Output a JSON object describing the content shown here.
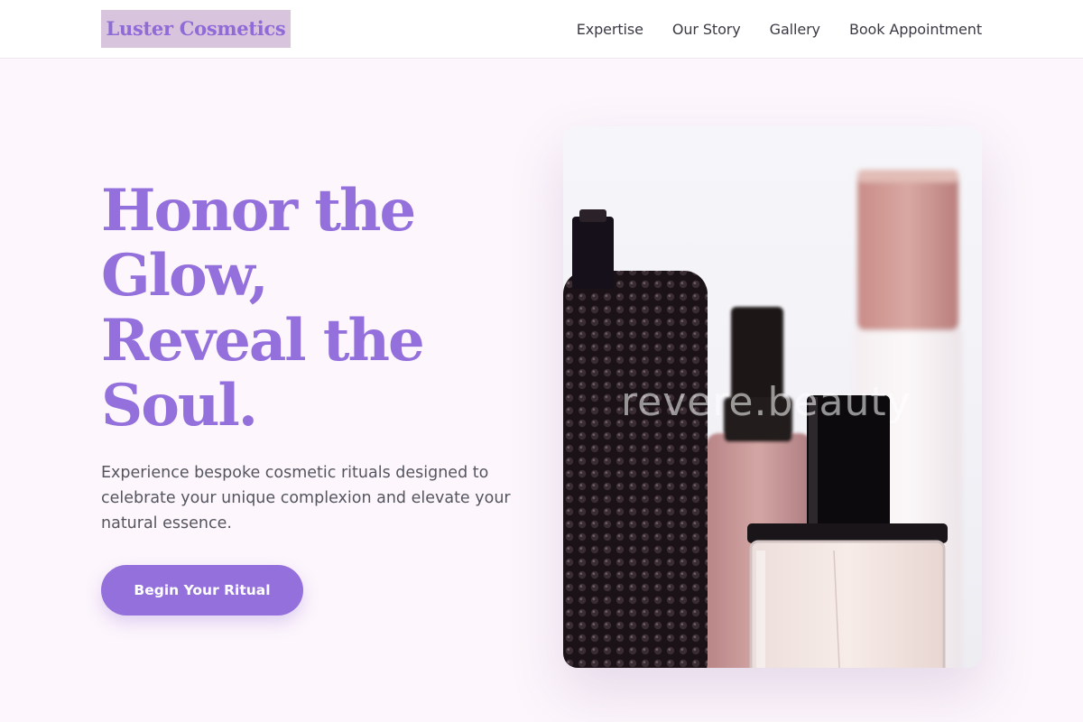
{
  "header": {
    "logo": "Luster Cosmetics",
    "nav": [
      "Expertise",
      "Our Story",
      "Gallery",
      "Book Appointment"
    ]
  },
  "hero": {
    "title_lines": [
      "Honor the",
      "Glow,",
      "Reveal the",
      "Soul."
    ],
    "description": "Experience bespoke cosmetic rituals designed to celebrate your unique complexion and elevate your natural essence.",
    "cta_label": "Begin Your Ritual",
    "image_watermark": "revere.beauty"
  },
  "colors": {
    "accent": "#9370db",
    "logo_background": "#d8c4dc",
    "page_background": "#fdf6fc"
  }
}
